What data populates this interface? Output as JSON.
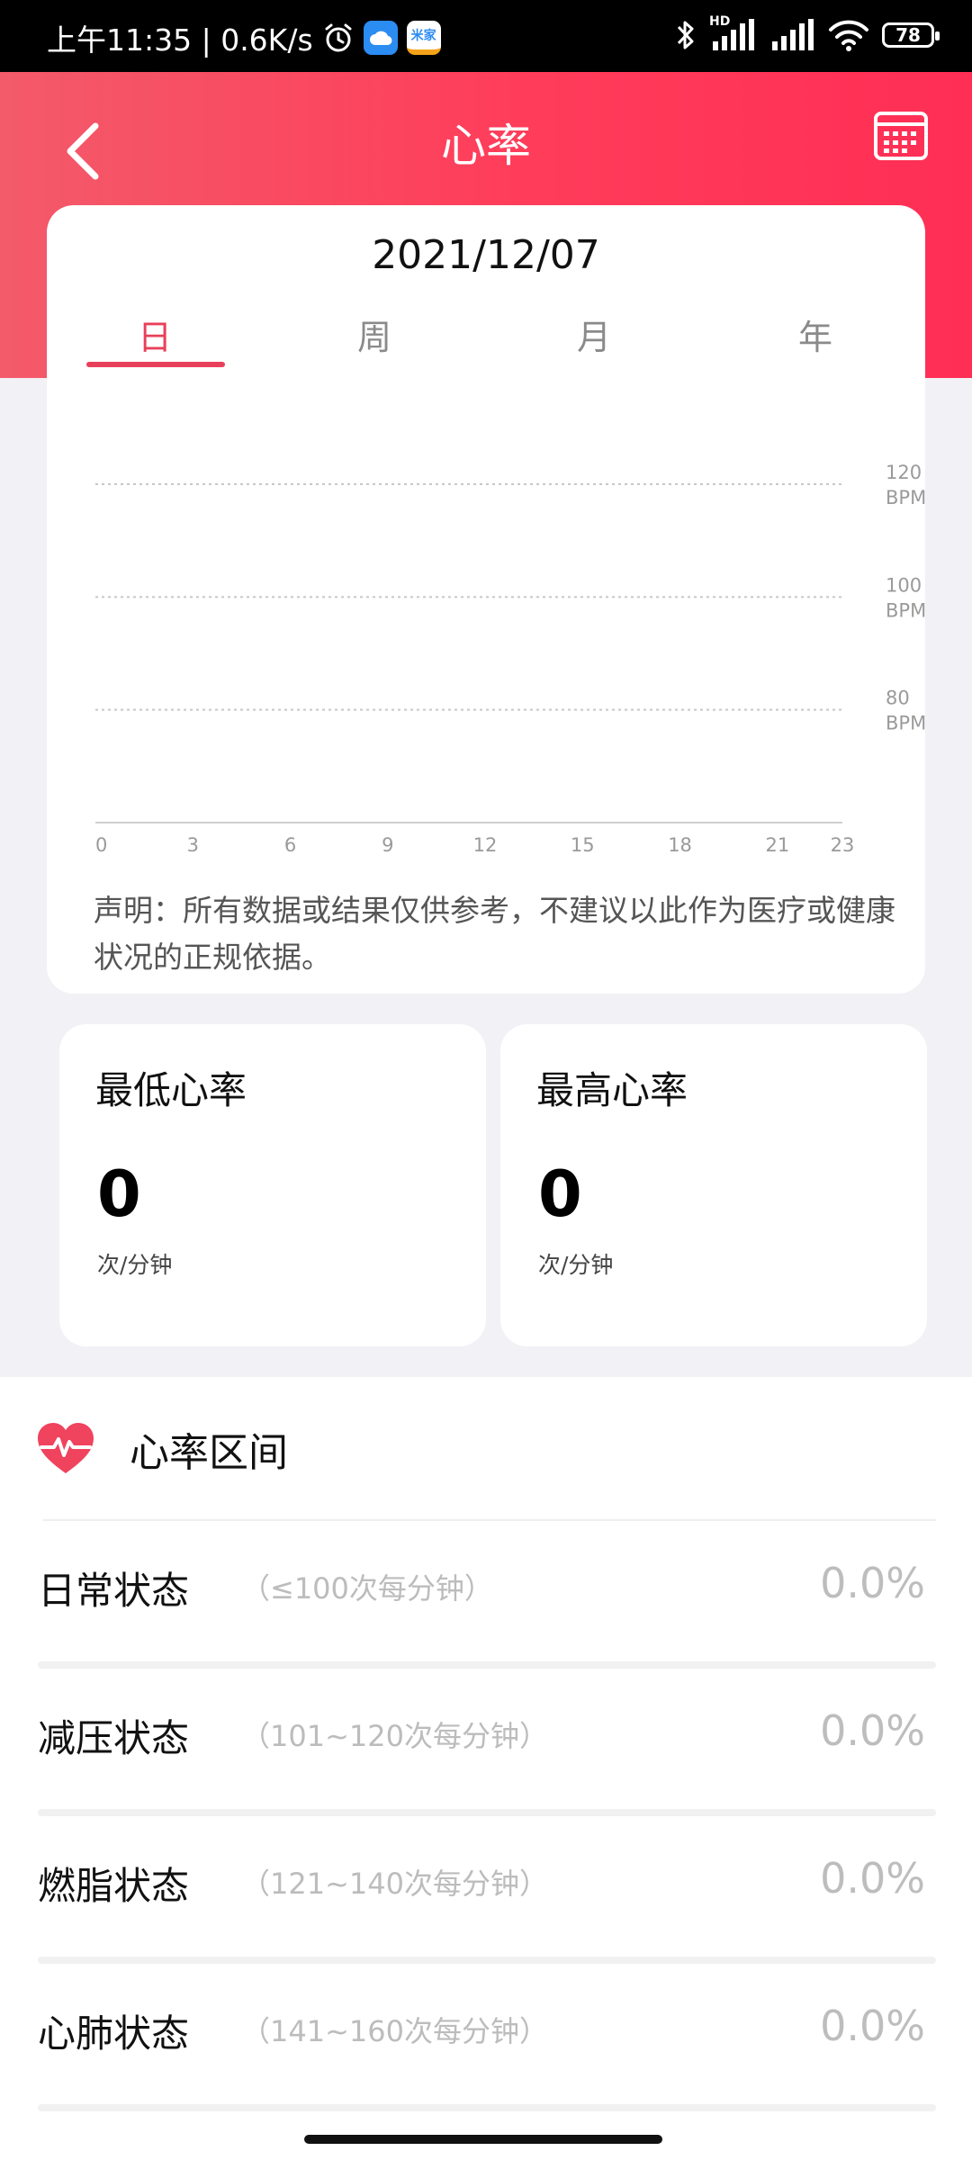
{
  "status_bar": {
    "time_text": "上午11:35 | 0.6K/s",
    "app_badge": "米家",
    "network": "HD",
    "battery": "78"
  },
  "header": {
    "title": "心率"
  },
  "chart_card": {
    "date": "2021/12/07",
    "tabs": [
      "日",
      "周",
      "月",
      "年"
    ],
    "active_tab": "日",
    "disclaimer": "声明：所有数据或结果仅供参考，不建议以此作为医疗或健康状况的正规依据。"
  },
  "chart_data": {
    "type": "line",
    "x_ticks": [
      "0",
      "3",
      "6",
      "9",
      "12",
      "15",
      "18",
      "21",
      "23"
    ],
    "y_ticks": [
      {
        "value": 120,
        "label": "120",
        "unit": "BPM"
      },
      {
        "value": 100,
        "label": "100",
        "unit": "BPM"
      },
      {
        "value": 80,
        "label": "80",
        "unit": "BPM"
      }
    ],
    "xlim": [
      0,
      23
    ],
    "ylim": [
      60,
      120
    ],
    "grid": true,
    "series": []
  },
  "stats": {
    "min": {
      "title": "最低心率",
      "value": "0",
      "unit": "次/分钟"
    },
    "max": {
      "title": "最高心率",
      "value": "0",
      "unit": "次/分钟"
    }
  },
  "zones": {
    "title": "心率区间",
    "accent_color": "#f0435d",
    "items": [
      {
        "name": "日常状态",
        "range": "（≤100次每分钟）",
        "percent": "0.0%"
      },
      {
        "name": "减压状态",
        "range": "（101~120次每分钟）",
        "percent": "0.0%"
      },
      {
        "name": "燃脂状态",
        "range": "（121~140次每分钟）",
        "percent": "0.0%"
      },
      {
        "name": "心肺状态",
        "range": "（141~160次每分钟）",
        "percent": "0.0%"
      }
    ]
  }
}
